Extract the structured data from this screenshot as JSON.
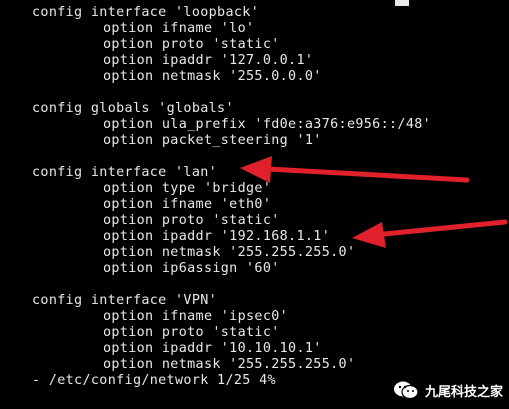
{
  "terminal": {
    "lines": [
      "config interface 'loopback'",
      "option ifname 'lo'",
      "option proto 'static'",
      "option ipaddr '127.0.0.1'",
      "option netmask '255.0.0.0'",
      "",
      "config globals 'globals'",
      "option ula_prefix 'fd0e:a376:e956::/48'",
      "option packet_steering '1'",
      "",
      "config interface 'lan'",
      "option type 'bridge'",
      "option ifname 'eth0'",
      "option proto 'static'",
      "option ipaddr '192.168.1.1'",
      "option netmask '255.255.255.0'",
      "option ip6assign '60'",
      "",
      "config interface 'VPN'",
      "option ifname 'ipsec0'",
      "option proto 'static'",
      "option ipaddr '10.10.10.1'",
      "option netmask '255.255.255.0'"
    ],
    "status_line": "- /etc/config/network 1/25 4%"
  },
  "watermark": {
    "text": "九尾科技之家",
    "icon": "wechat-icon"
  },
  "colors": {
    "background": "#000000",
    "text": "#e8e8e8",
    "arrow": "#e0202a"
  }
}
